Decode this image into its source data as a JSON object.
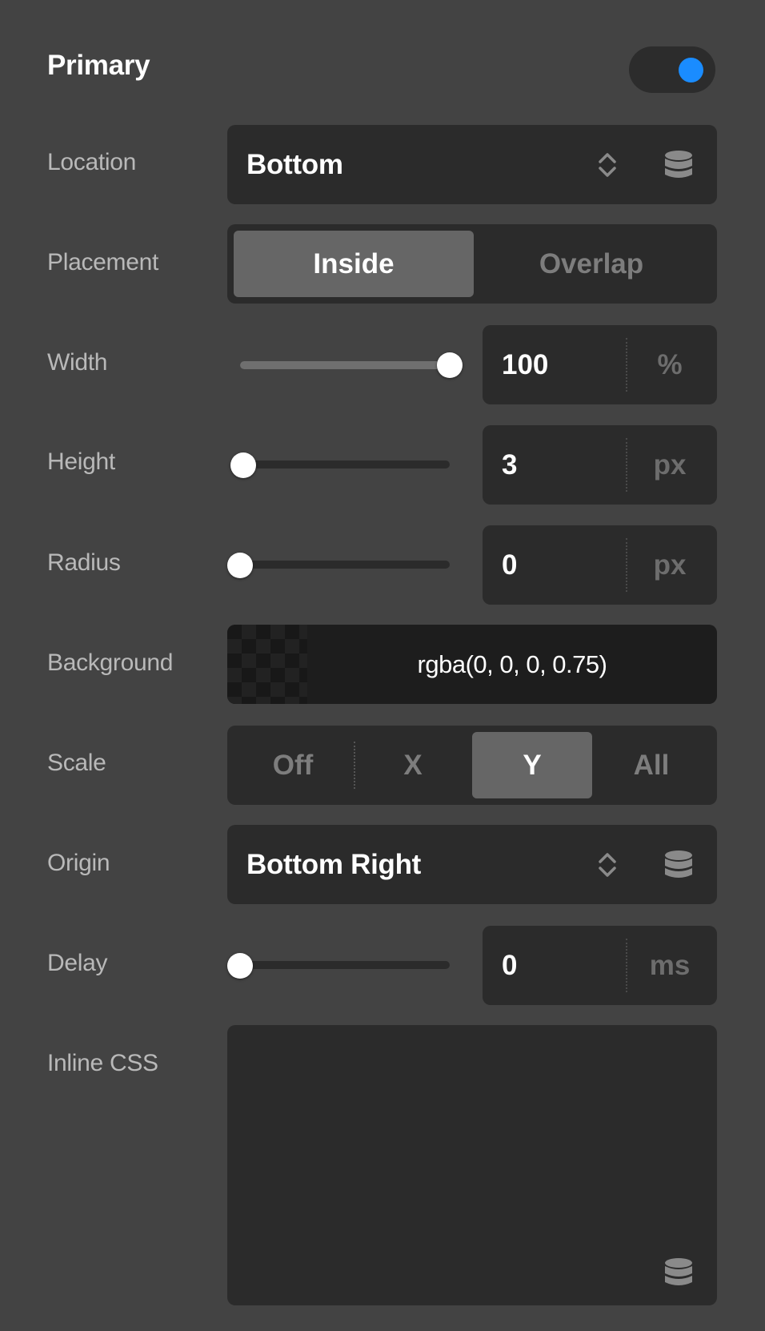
{
  "section": {
    "title": "Primary",
    "enabled": true
  },
  "location": {
    "label": "Location",
    "value": "Bottom"
  },
  "placement": {
    "label": "Placement",
    "options": [
      "Inside",
      "Overlap"
    ],
    "selected": "Inside"
  },
  "width": {
    "label": "Width",
    "value": "100",
    "unit": "%",
    "slider_fraction": 1.0
  },
  "height": {
    "label": "Height",
    "value": "3",
    "unit": "px",
    "slider_fraction": 0.0
  },
  "radius": {
    "label": "Radius",
    "value": "0",
    "unit": "px",
    "slider_fraction": 0.0
  },
  "background": {
    "label": "Background",
    "value": "rgba(0, 0, 0, 0.75)"
  },
  "scale": {
    "label": "Scale",
    "options": [
      "Off",
      "X",
      "Y",
      "All"
    ],
    "selected": "Y"
  },
  "origin": {
    "label": "Origin",
    "value": "Bottom Right"
  },
  "delay": {
    "label": "Delay",
    "value": "0",
    "unit": "ms",
    "slider_fraction": 0.0
  },
  "inline_css": {
    "label": "Inline CSS",
    "value": ""
  },
  "colors": {
    "toggle_on": "#1a8cff",
    "panel_bg": "#434343",
    "field_bg": "#2b2b2b"
  },
  "icons": {
    "select_arrows": "chevron-up-down-icon",
    "dynamic_data": "database-icon"
  }
}
